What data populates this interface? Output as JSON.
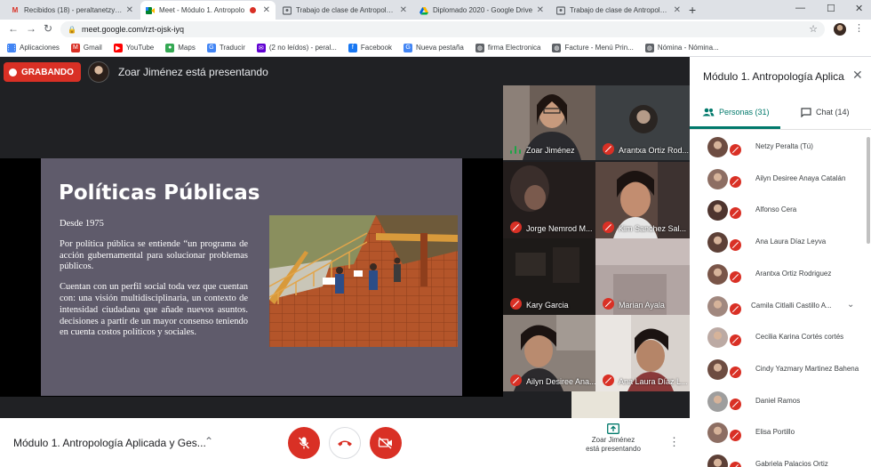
{
  "browser": {
    "tabs": [
      {
        "title": "Recibidos (18) - peraltanetzy@gm",
        "favicon": "gmail-icon",
        "active": false
      },
      {
        "title": "Meet - Módulo 1. Antropolo",
        "favicon": "meet-icon",
        "active": true,
        "recording": true
      },
      {
        "title": "Trabajo de clase de Antropología",
        "favicon": "classroom-icon",
        "active": false
      },
      {
        "title": "Diplomado 2020 - Google Drive",
        "favicon": "drive-icon",
        "active": false
      },
      {
        "title": "Trabajo de clase de Antropología",
        "favicon": "classroom-icon",
        "active": false
      }
    ],
    "new_tab_symbol": "+",
    "url": "meet.google.com/rzt-ojsk-iyq",
    "bookmarks": [
      {
        "label": "Aplicaciones",
        "icon": "apps-grid-icon",
        "color": "#4285f4"
      },
      {
        "label": "Gmail",
        "icon": "gmail-icon",
        "color": "#d93025"
      },
      {
        "label": "YouTube",
        "icon": "youtube-icon",
        "color": "#ff0000"
      },
      {
        "label": "Maps",
        "icon": "maps-pin-icon",
        "color": "#34a853"
      },
      {
        "label": "Traducir",
        "icon": "translate-icon",
        "color": "#4285f4"
      },
      {
        "label": "(2 no leídos) - peral...",
        "icon": "yahoo-mail-icon",
        "color": "#6001d2"
      },
      {
        "label": "Facebook",
        "icon": "facebook-icon",
        "color": "#1877f2"
      },
      {
        "label": "Nueva pestaña",
        "icon": "google-icon",
        "color": "#4285f4"
      },
      {
        "label": "firma Electronica",
        "icon": "globe-icon",
        "color": "#5f6368"
      },
      {
        "label": "Facture - Menú Prin...",
        "icon": "globe-icon",
        "color": "#5f6368"
      },
      {
        "label": "Nómina - Nómina...",
        "icon": "globe-icon",
        "color": "#5f6368"
      }
    ]
  },
  "meet": {
    "recording_label": "GRABANDO",
    "presenting_text": "Zoar Jiménez está presentando",
    "slide": {
      "title": "Políticas Públicas",
      "paragraphs": [
        "Desde 1975",
        "Por política pública se entiende “un programa de acción gubernamental para solucionar problemas públicos.",
        "Cuentan con un perfil social toda vez que cuentan con: una visión multidisciplinaria, un contexto de intensidad ciudadana que añade nuevos asuntos. decisiones a partir de un mayor consenso teniendo en cuenta costos políticos y sociales."
      ]
    },
    "tiles": [
      {
        "name": "Zoar Jiménez",
        "speaking": true
      },
      {
        "name": "Arantxa Ortiz Rod...",
        "speaking": false
      },
      {
        "name": "Jorge Nemrod M...",
        "speaking": false
      },
      {
        "name": "Kim Sanchez Sal...",
        "speaking": false
      },
      {
        "name": "Kary Garcia",
        "speaking": false
      },
      {
        "name": "Marian Ayala",
        "speaking": false
      },
      {
        "name": "Ailyn Desiree Ana...",
        "speaking": false
      },
      {
        "name": "Ana Laura Díaz L...",
        "speaking": false
      }
    ],
    "meeting_title": "Módulo 1. Antropología Aplicada y Ges...",
    "presenting_button": {
      "line1": "Zoar Jiménez",
      "line2": "está presentando"
    },
    "colors": {
      "record_red": "#d93025",
      "accent_teal": "#00796b",
      "stage_bg": "#202124",
      "slide_bg": "#5f5b6b"
    }
  },
  "panel": {
    "title": "Módulo 1. Antropología Aplica...",
    "people_tab": "Personas (31)",
    "chat_tab": "Chat (14)",
    "people": [
      {
        "name": "Netzy Peralta (Tú)"
      },
      {
        "name": "Ailyn Desiree Anaya Catalán"
      },
      {
        "name": "Alfonso Cera"
      },
      {
        "name": "Ana Laura Díaz Leyva"
      },
      {
        "name": "Arantxa Ortiz Rodriguez"
      },
      {
        "name": "Camila Citlalli Castillo A...",
        "expandable": true
      },
      {
        "name": "Cecilia Karina Cortés cortés"
      },
      {
        "name": "Cindy Yazmary Martinez Bahena"
      },
      {
        "name": "Daniel Ramos"
      },
      {
        "name": "Elisa Portillo"
      },
      {
        "name": "Gabriela Palacios Ortiz"
      }
    ]
  }
}
